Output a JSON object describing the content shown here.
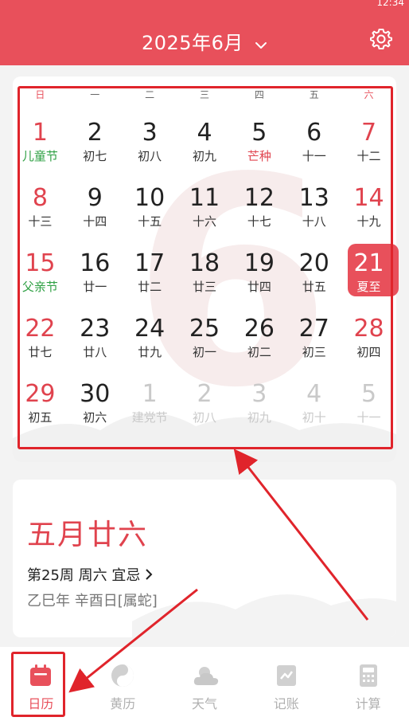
{
  "header": {
    "title": "2025年6月",
    "status_text": "12:34"
  },
  "calendar": {
    "weekdays": [
      "日",
      "一",
      "二",
      "三",
      "四",
      "五",
      "六"
    ],
    "bg_month": "6",
    "days": [
      {
        "num": "1",
        "sub": "儿童节"
      },
      {
        "num": "2",
        "sub": "初七"
      },
      {
        "num": "3",
        "sub": "初八"
      },
      {
        "num": "4",
        "sub": "初九"
      },
      {
        "num": "5",
        "sub": "芒种"
      },
      {
        "num": "6",
        "sub": "十一"
      },
      {
        "num": "7",
        "sub": "十二"
      },
      {
        "num": "8",
        "sub": "十三"
      },
      {
        "num": "9",
        "sub": "十四"
      },
      {
        "num": "10",
        "sub": "十五"
      },
      {
        "num": "11",
        "sub": "十六"
      },
      {
        "num": "12",
        "sub": "十七"
      },
      {
        "num": "13",
        "sub": "十八"
      },
      {
        "num": "14",
        "sub": "十九"
      },
      {
        "num": "15",
        "sub": "父亲节"
      },
      {
        "num": "16",
        "sub": "廿一"
      },
      {
        "num": "17",
        "sub": "廿二"
      },
      {
        "num": "18",
        "sub": "廿三"
      },
      {
        "num": "19",
        "sub": "廿四"
      },
      {
        "num": "20",
        "sub": "廿五"
      },
      {
        "num": "21",
        "sub": "夏至"
      },
      {
        "num": "22",
        "sub": "廿七"
      },
      {
        "num": "23",
        "sub": "廿八"
      },
      {
        "num": "24",
        "sub": "廿九"
      },
      {
        "num": "25",
        "sub": "初一"
      },
      {
        "num": "26",
        "sub": "初二"
      },
      {
        "num": "27",
        "sub": "初三"
      },
      {
        "num": "28",
        "sub": "初四"
      },
      {
        "num": "29",
        "sub": "初五"
      },
      {
        "num": "30",
        "sub": "初六"
      },
      {
        "num": "1",
        "sub": "建党节"
      },
      {
        "num": "2",
        "sub": "初八"
      },
      {
        "num": "3",
        "sub": "初九"
      },
      {
        "num": "4",
        "sub": "初十"
      },
      {
        "num": "5",
        "sub": "十一"
      }
    ]
  },
  "lunar": {
    "title": "五月廿六",
    "week_line": "第25周 周六 宜忌",
    "ganzhi": "乙巳年 辛酉日[属蛇]"
  },
  "tabs": [
    {
      "label": "日历",
      "icon": "calendar-icon"
    },
    {
      "label": "黄历",
      "icon": "yin-yang-icon"
    },
    {
      "label": "天气",
      "icon": "weather-icon"
    },
    {
      "label": "记账",
      "icon": "ledger-icon"
    },
    {
      "label": "计算",
      "icon": "calculator-icon"
    }
  ],
  "colors": {
    "accent": "#e8505b",
    "highlight": "#e0242b",
    "festival": "#2ea043"
  }
}
